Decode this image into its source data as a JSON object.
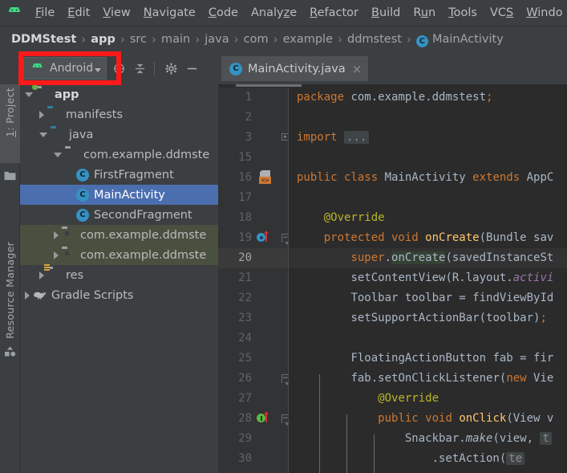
{
  "app": {
    "logo_icon": "android-robot-icon"
  },
  "menubar": {
    "items": [
      {
        "label": "File",
        "mnemonic": "F"
      },
      {
        "label": "Edit",
        "mnemonic": "E"
      },
      {
        "label": "View",
        "mnemonic": "V"
      },
      {
        "label": "Navigate",
        "mnemonic": "N"
      },
      {
        "label": "Code",
        "mnemonic": "C"
      },
      {
        "label": "Analyze",
        "mnemonic": "z"
      },
      {
        "label": "Refactor",
        "mnemonic": "R"
      },
      {
        "label": "Build",
        "mnemonic": "B"
      },
      {
        "label": "Run",
        "mnemonic": "u"
      },
      {
        "label": "Tools",
        "mnemonic": "T"
      },
      {
        "label": "VCS",
        "mnemonic": "S"
      },
      {
        "label": "Windo",
        "mnemonic": "W"
      }
    ]
  },
  "breadcrumb": {
    "separator": "›",
    "items": [
      {
        "label": "DDMStest",
        "strong": true,
        "icon": null
      },
      {
        "label": "app",
        "strong": true,
        "icon": null
      },
      {
        "label": "src",
        "strong": false,
        "icon": null
      },
      {
        "label": "main",
        "strong": false,
        "icon": null
      },
      {
        "label": "java",
        "strong": false,
        "icon": null
      },
      {
        "label": "com",
        "strong": false,
        "icon": null
      },
      {
        "label": "example",
        "strong": false,
        "icon": null
      },
      {
        "label": "ddmstest",
        "strong": false,
        "icon": null
      },
      {
        "label": "MainActivity",
        "strong": false,
        "icon": "class-icon",
        "icon_letter": "C"
      }
    ]
  },
  "toolwindow": {
    "title": "Android",
    "title_icon": "android-robot-icon",
    "dropdown_icon": "chevron-down-icon",
    "buttons": [
      {
        "name": "select-opened-file-icon",
        "tooltip": "Select Opened File"
      },
      {
        "name": "collapse-all-icon",
        "tooltip": "Collapse All"
      },
      {
        "name": "settings-gear-icon",
        "tooltip": "Settings"
      },
      {
        "name": "hide-icon",
        "tooltip": "Hide"
      }
    ]
  },
  "left_stripe": {
    "project_label": "1: Project",
    "project_mnemonic": "1",
    "project_icon": "folder-icon",
    "resource_manager_label": "Resource Manager",
    "resource_manager_icon": "resource-shapes-icon"
  },
  "editor_tabs": [
    {
      "label": "MainActivity.java",
      "icon": "class-icon",
      "icon_letter": "C",
      "close": "×",
      "active": true
    }
  ],
  "project_tree": [
    {
      "label": "app",
      "indent": 0,
      "twisty": "open",
      "icon": "module-folder-icon",
      "bold": true,
      "state": "normal"
    },
    {
      "label": "manifests",
      "indent": 1,
      "twisty": "closed",
      "icon": "folder-blue-icon",
      "bold": false,
      "state": "normal"
    },
    {
      "label": "java",
      "indent": 1,
      "twisty": "open",
      "icon": "folder-blue-icon",
      "bold": false,
      "state": "normal"
    },
    {
      "label": "com.example.ddmste",
      "indent": 2,
      "twisty": "open",
      "icon": "package-icon",
      "bold": false,
      "state": "normal"
    },
    {
      "label": "FirstFragment",
      "indent": 3,
      "twisty": "none",
      "icon": "class-icon",
      "icon_letter": "C",
      "bold": false,
      "state": "normal"
    },
    {
      "label": "MainActivity",
      "indent": 3,
      "twisty": "none",
      "icon": "class-icon",
      "icon_letter": "C",
      "bold": false,
      "state": "selected"
    },
    {
      "label": "SecondFragment",
      "indent": 3,
      "twisty": "none",
      "icon": "class-icon",
      "icon_letter": "C",
      "bold": false,
      "state": "normal"
    },
    {
      "label": "com.example.ddmste",
      "indent": 2,
      "twisty": "closed",
      "icon": "package-icon",
      "bold": false,
      "state": "testsource"
    },
    {
      "label": "com.example.ddmste",
      "indent": 2,
      "twisty": "closed",
      "icon": "package-icon",
      "bold": false,
      "state": "testsource"
    },
    {
      "label": "res",
      "indent": 1,
      "twisty": "closed",
      "icon": "res-folder-icon",
      "bold": false,
      "state": "normal"
    },
    {
      "label": "Gradle Scripts",
      "indent": 0,
      "twisty": "closed",
      "icon": "gradle-elephant-icon",
      "bold": false,
      "state": "normal"
    }
  ],
  "editor": {
    "current_line": 20,
    "lines": [
      {
        "num": 1,
        "indent": 0,
        "tokens": [
          {
            "t": "package ",
            "c": "kw"
          },
          {
            "t": "com.example.ddmstest",
            "c": "pun"
          },
          {
            "t": ";",
            "c": "kw"
          }
        ]
      },
      {
        "num": 2,
        "indent": 0,
        "tokens": []
      },
      {
        "num": 3,
        "indent": 0,
        "fold": "plus",
        "tokens": [
          {
            "t": "import ",
            "c": "kw"
          },
          {
            "t": "...",
            "c": "foldbadge"
          }
        ]
      },
      {
        "num": 15,
        "indent": 0,
        "tokens": []
      },
      {
        "num": 16,
        "indent": 0,
        "gutter_icon": "bean-class-icon",
        "tokens": [
          {
            "t": "public class ",
            "c": "kw"
          },
          {
            "t": "MainActivity",
            "c": "pun"
          },
          {
            "t": " extends ",
            "c": "kw"
          },
          {
            "t": "AppC",
            "c": "pun"
          }
        ]
      },
      {
        "num": 17,
        "indent": 0,
        "tokens": []
      },
      {
        "num": 18,
        "indent": 1,
        "tokens": [
          {
            "t": "@Override",
            "c": "ann"
          }
        ]
      },
      {
        "num": 19,
        "indent": 1,
        "gutter_icon": "overriding-method-icon",
        "fold": "arm-start",
        "tokens": [
          {
            "t": "protected void ",
            "c": "kw"
          },
          {
            "t": "onCreate",
            "c": "fn"
          },
          {
            "t": "(Bundle sav",
            "c": "pun"
          }
        ]
      },
      {
        "num": 20,
        "indent": 2,
        "tokens": [
          {
            "t": "super",
            "c": "kw"
          },
          {
            "t": ".",
            "c": "pun"
          },
          {
            "t": "onCreate",
            "c": "hl"
          },
          {
            "t": "(savedInstanceSt",
            "c": "pun"
          }
        ]
      },
      {
        "num": 21,
        "indent": 2,
        "tokens": [
          {
            "t": "setContentView(R.layout.",
            "c": "pun"
          },
          {
            "t": "activi",
            "c": "fld"
          }
        ]
      },
      {
        "num": 22,
        "indent": 2,
        "tokens": [
          {
            "t": "Toolbar toolbar = findViewById",
            "c": "pun"
          }
        ]
      },
      {
        "num": 23,
        "indent": 2,
        "tokens": [
          {
            "t": "setSupportActionBar(toolbar)",
            "c": "pun"
          },
          {
            "t": ";",
            "c": "kw"
          }
        ]
      },
      {
        "num": 24,
        "indent": 2,
        "tokens": []
      },
      {
        "num": 25,
        "indent": 2,
        "tokens": [
          {
            "t": "FloatingActionButton fab = fir",
            "c": "pun"
          }
        ]
      },
      {
        "num": 26,
        "indent": 2,
        "fold": "arm-start",
        "tokens": [
          {
            "t": "fab.setOnClickListener(",
            "c": "pun"
          },
          {
            "t": "new ",
            "c": "kw"
          },
          {
            "t": "Vie",
            "c": "pun"
          }
        ]
      },
      {
        "num": 27,
        "indent": 3,
        "tokens": [
          {
            "t": "@Override",
            "c": "ann"
          }
        ]
      },
      {
        "num": 28,
        "indent": 3,
        "gutter_icon": "implementing-method-icon",
        "fold": "arm-start",
        "tokens": [
          {
            "t": "public void ",
            "c": "kw"
          },
          {
            "t": "onClick",
            "c": "fn"
          },
          {
            "t": "(View v",
            "c": "pun"
          }
        ]
      },
      {
        "num": 29,
        "indent": 4,
        "tokens": [
          {
            "t": "Snackbar.",
            "c": "pun"
          },
          {
            "t": "make",
            "c": "mth"
          },
          {
            "t": "(view, ",
            "c": "pun"
          },
          {
            "t": "t",
            "c": "foldbadge"
          }
        ]
      },
      {
        "num": 30,
        "indent": 5,
        "tokens": [
          {
            "t": ".setAction(",
            "c": "pun"
          },
          {
            "t": "te",
            "c": "foldbadge"
          }
        ]
      }
    ]
  },
  "annotation": {
    "shape": "rectangle",
    "color": "#ff1a1a",
    "target": "android-toolwindow-dropdown"
  },
  "colors": {
    "window_bg": "#3c3f41",
    "editor_bg": "#2b2b2b",
    "gutter_bg": "#313335",
    "selection_blue": "#4b6eaf",
    "test_source_green": "#4a5040",
    "accent_android_green": "#3ddc84",
    "class_icon_blue": "#3592c4",
    "annotation_red": "#ff1a1a"
  }
}
